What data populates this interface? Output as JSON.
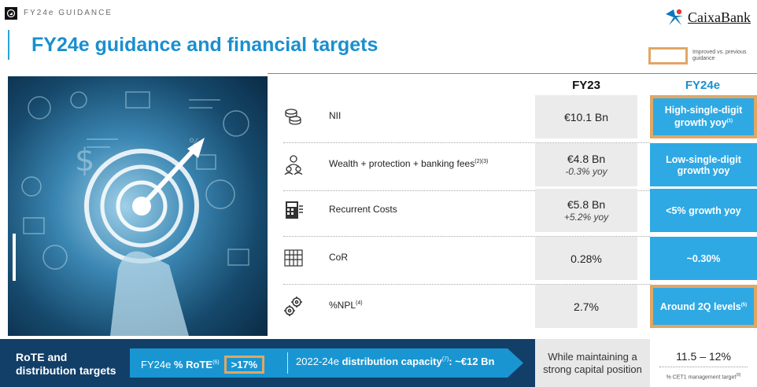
{
  "header": {
    "section_label": "FY24e GUIDANCE",
    "page_title": "FY24e guidance and financial targets",
    "logo_text": "CaixaBank"
  },
  "legend": {
    "label": "Improved vs. previous guidance"
  },
  "columns": {
    "fy23": "FY23",
    "fy24": "FY24e"
  },
  "rows": [
    {
      "label": "NII",
      "sup": "",
      "icon": "coins-icon",
      "fy23": "€10.1 Bn",
      "fy23_sub": "",
      "fy24": "High-single-digit growth yoy",
      "fy24_sup": "(1)",
      "improved": true
    },
    {
      "label": "Wealth + protection + banking fees",
      "sup": "(2)(3)",
      "icon": "advisor-icon",
      "fy23": "€4.8 Bn",
      "fy23_sub": "-0.3% yoy",
      "fy24": "Low-single-digit growth yoy",
      "fy24_sup": "",
      "improved": false
    },
    {
      "label": "Recurrent Costs",
      "sup": "",
      "icon": "calculator-icon",
      "fy23": "€5.8 Bn",
      "fy23_sub": "+5.2% yoy",
      "fy24": "<5% growth yoy",
      "fy24_sup": "",
      "improved": false
    },
    {
      "label": "CoR",
      "sup": "",
      "icon": "abacus-icon",
      "fy23": "0.28%",
      "fy23_sub": "",
      "fy24": "~0.30%",
      "fy24_sup": "",
      "improved": false
    },
    {
      "label": "%NPL",
      "sup": "(4)",
      "icon": "gears-icon",
      "fy23": "2.7%",
      "fy23_sub": "",
      "fy24": "Around 2Q levels",
      "fy24_sup": "(5)",
      "improved": true
    }
  ],
  "bottom": {
    "title_line1": "RoTE and",
    "title_line2": "distribution targets",
    "rote_prefix": "FY24e",
    "rote_bold": "% RoTE",
    "rote_sup": "(6)",
    "rote_value": ">17%",
    "dist_prefix": "2022-24e",
    "dist_bold": "distribution capacity",
    "dist_sup": "(7)",
    "dist_value": ": ~€12 Bn",
    "capital_text": "While maintaining a strong capital position",
    "cet1_range": "11.5 – 12%",
    "cet1_note": "% CET1 management target",
    "cet1_note_sup": "(8)"
  },
  "colors": {
    "accent_blue": "#2fa9e4",
    "title_blue": "#1a8fcf",
    "navy": "#123f68",
    "highlight_orange": "#e0a765"
  }
}
